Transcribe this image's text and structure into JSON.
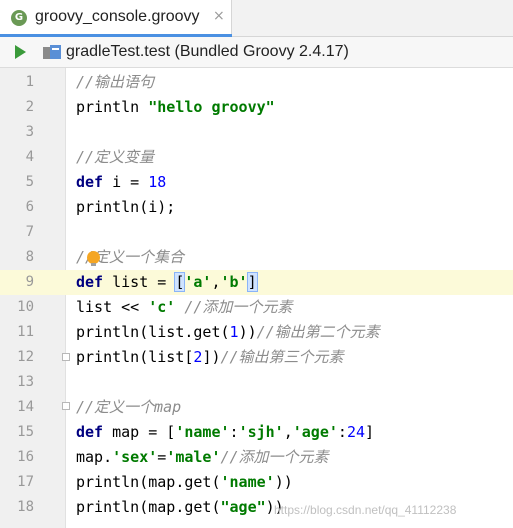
{
  "tab": {
    "badge": "G",
    "label": "groovy_console.groovy",
    "close": "×"
  },
  "toolbar": {
    "module_label": "gradleTest.test (Bundled Groovy 2.4.17)"
  },
  "editor": {
    "current_line": 9,
    "lines": [
      {
        "n": "1"
      },
      {
        "n": "2"
      },
      {
        "n": "3"
      },
      {
        "n": "4"
      },
      {
        "n": "5"
      },
      {
        "n": "6"
      },
      {
        "n": "7"
      },
      {
        "n": "8"
      },
      {
        "n": "9"
      },
      {
        "n": "10"
      },
      {
        "n": "11"
      },
      {
        "n": "12"
      },
      {
        "n": "13"
      },
      {
        "n": "14"
      },
      {
        "n": "15"
      },
      {
        "n": "16"
      },
      {
        "n": "17"
      },
      {
        "n": "18"
      }
    ],
    "tokens": {
      "l1_cmt": "//输出语句",
      "l2_fn": "println ",
      "l2_str": "\"hello groovy\"",
      "l4_cmt": "//定义变量",
      "l5_kw": "def",
      "l5_rest": " i = ",
      "l5_num": "18",
      "l6": "println(i);",
      "l8_cmt": "//定义一个集合",
      "l9_kw": "def",
      "l9_rest": " list = ",
      "l9_open": "[",
      "l9_a": "'a'",
      "l9_comma": ",",
      "l9_b": "'b'",
      "l9_close": "]",
      "l10_rest": "list << ",
      "l10_str": "'c'",
      "l10_cmt": " //添加一个元素",
      "l11_a": "println(list.get(",
      "l11_num": "1",
      "l11_b": "))",
      "l11_cmt": "//输出第二个元素",
      "l12_a": "println(list[",
      "l12_num": "2",
      "l12_b": "])",
      "l12_cmt": "//输出第三个元素",
      "l14_cmt": "//定义一个map",
      "l15_kw": "def",
      "l15_a": " map = [",
      "l15_s1": "'name'",
      "l15_c1": ":",
      "l15_s2": "'sjh'",
      "l15_c2": ",",
      "l15_s3": "'age'",
      "l15_c3": ":",
      "l15_num": "24",
      "l15_b": "]",
      "l16_a": "map.",
      "l16_s1": "'sex'",
      "l16_eq": "=",
      "l16_s2": "'male'",
      "l16_cmt": "//添加一个元素",
      "l17_a": "println(map.get(",
      "l17_s": "'name'",
      "l17_b": "))",
      "l18_a": "println(map.get(",
      "l18_s": "\"age\"",
      "l18_b": "))"
    }
  },
  "watermark": "https://blog.csdn.net/qq_41112238",
  "colors": {
    "keyword": "#000080",
    "string": "#007a00",
    "number": "#0000ff",
    "comment": "#8c8c8c",
    "current_line": "#fcfad9"
  }
}
